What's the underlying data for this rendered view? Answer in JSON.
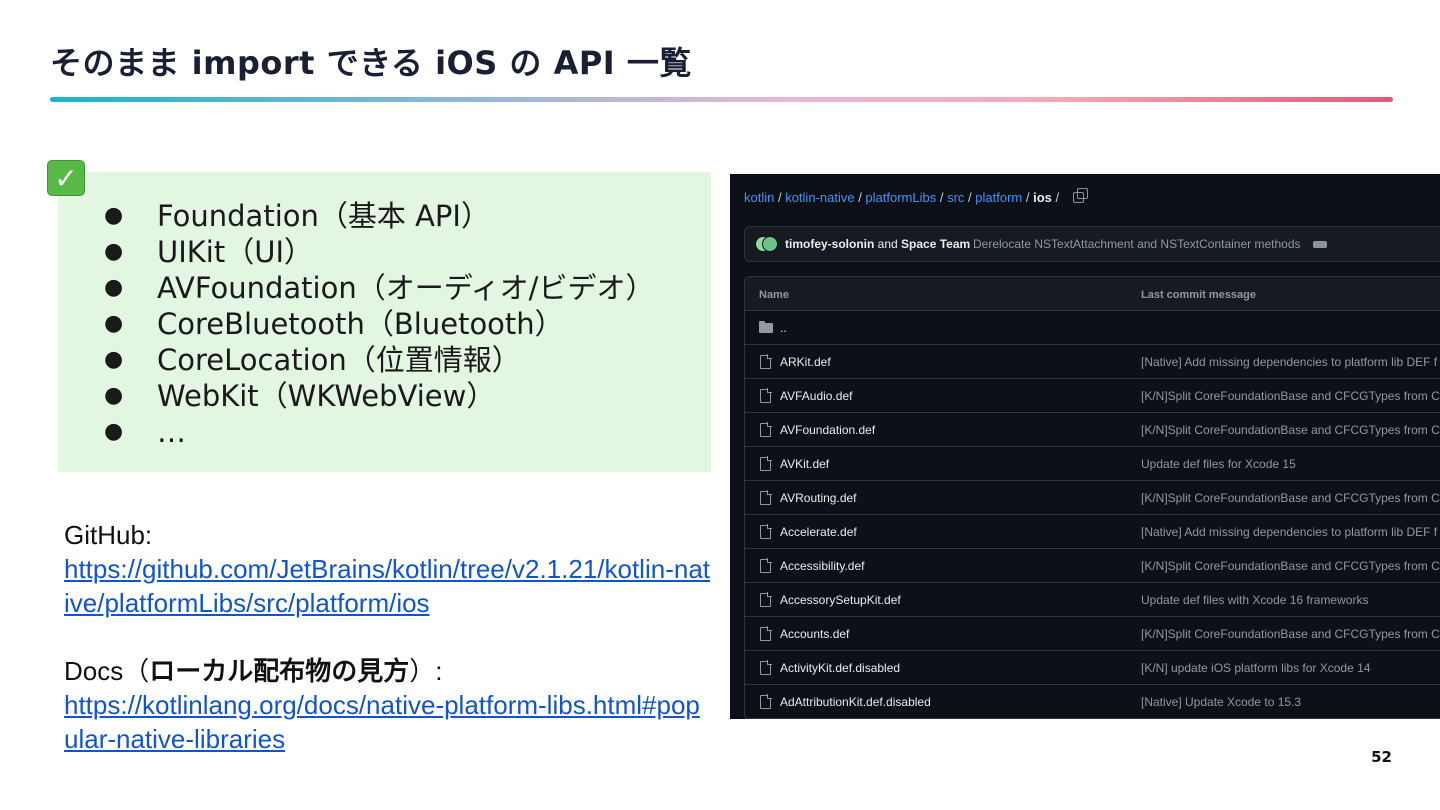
{
  "slide": {
    "title": "そのまま import できる iOS の  API 一覧",
    "page_number": "52",
    "accent_gradient": [
      "#1bb3c8",
      "#e6b8d6",
      "#e05a73"
    ]
  },
  "api_box": {
    "icon": "check-mark-icon",
    "bullet": "●",
    "items": [
      "Foundation（基本 API）",
      "UIKit（UI）",
      "AVFoundation（オーディオ/ビデオ）",
      "CoreBluetooth（Bluetooth）",
      "CoreLocation（位置情報）",
      "WebKit（WKWebView）",
      "…"
    ]
  },
  "links": {
    "github_label": "GitHub:",
    "github_url": "https://github.com/JetBrains/kotlin/tree/v2.1.21/kotlin-native/platformLibs/src/platform/ios",
    "docs_label_prefix": "Docs（",
    "docs_label_bold": "ローカル配布物の見方",
    "docs_label_suffix": "）:",
    "docs_url": "https://kotlinlang.org/docs/native-platform-libs.html#popular-native-libraries"
  },
  "github": {
    "breadcrumb": [
      "kotlin",
      "kotlin-native",
      "platformLibs",
      "src",
      "platform"
    ],
    "breadcrumb_current": "ios",
    "separator": " / ",
    "commit_author": "timofey-solonin",
    "commit_and": " and ",
    "commit_team": "Space Team",
    "commit_message": "Derelocate NSTextAttachment and NSTextContainer methods",
    "col_name": "Name",
    "col_message": "Last commit message",
    "parent_dir": "..",
    "files": [
      {
        "name": "ARKit.def",
        "message": "[Native] Add missing dependencies to platform lib DEF f"
      },
      {
        "name": "AVFAudio.def",
        "message": "[K/N]Split CoreFoundationBase and CFCGTypes from Co"
      },
      {
        "name": "AVFoundation.def",
        "message": "[K/N]Split CoreFoundationBase and CFCGTypes from Co"
      },
      {
        "name": "AVKit.def",
        "message": "Update def files for Xcode 15"
      },
      {
        "name": "AVRouting.def",
        "message": "[K/N]Split CoreFoundationBase and CFCGTypes from Co"
      },
      {
        "name": "Accelerate.def",
        "message": "[Native] Add missing dependencies to platform lib DEF f"
      },
      {
        "name": "Accessibility.def",
        "message": "[K/N]Split CoreFoundationBase and CFCGTypes from Co"
      },
      {
        "name": "AccessorySetupKit.def",
        "message": "Update def files with Xcode 16 frameworks"
      },
      {
        "name": "Accounts.def",
        "message": "[K/N]Split CoreFoundationBase and CFCGTypes from Co"
      },
      {
        "name": "ActivityKit.def.disabled",
        "message": "[K/N] update iOS platform libs for Xcode 14"
      },
      {
        "name": "AdAttributionKit.def.disabled",
        "message": "[Native] Update Xcode to 15.3"
      }
    ]
  }
}
